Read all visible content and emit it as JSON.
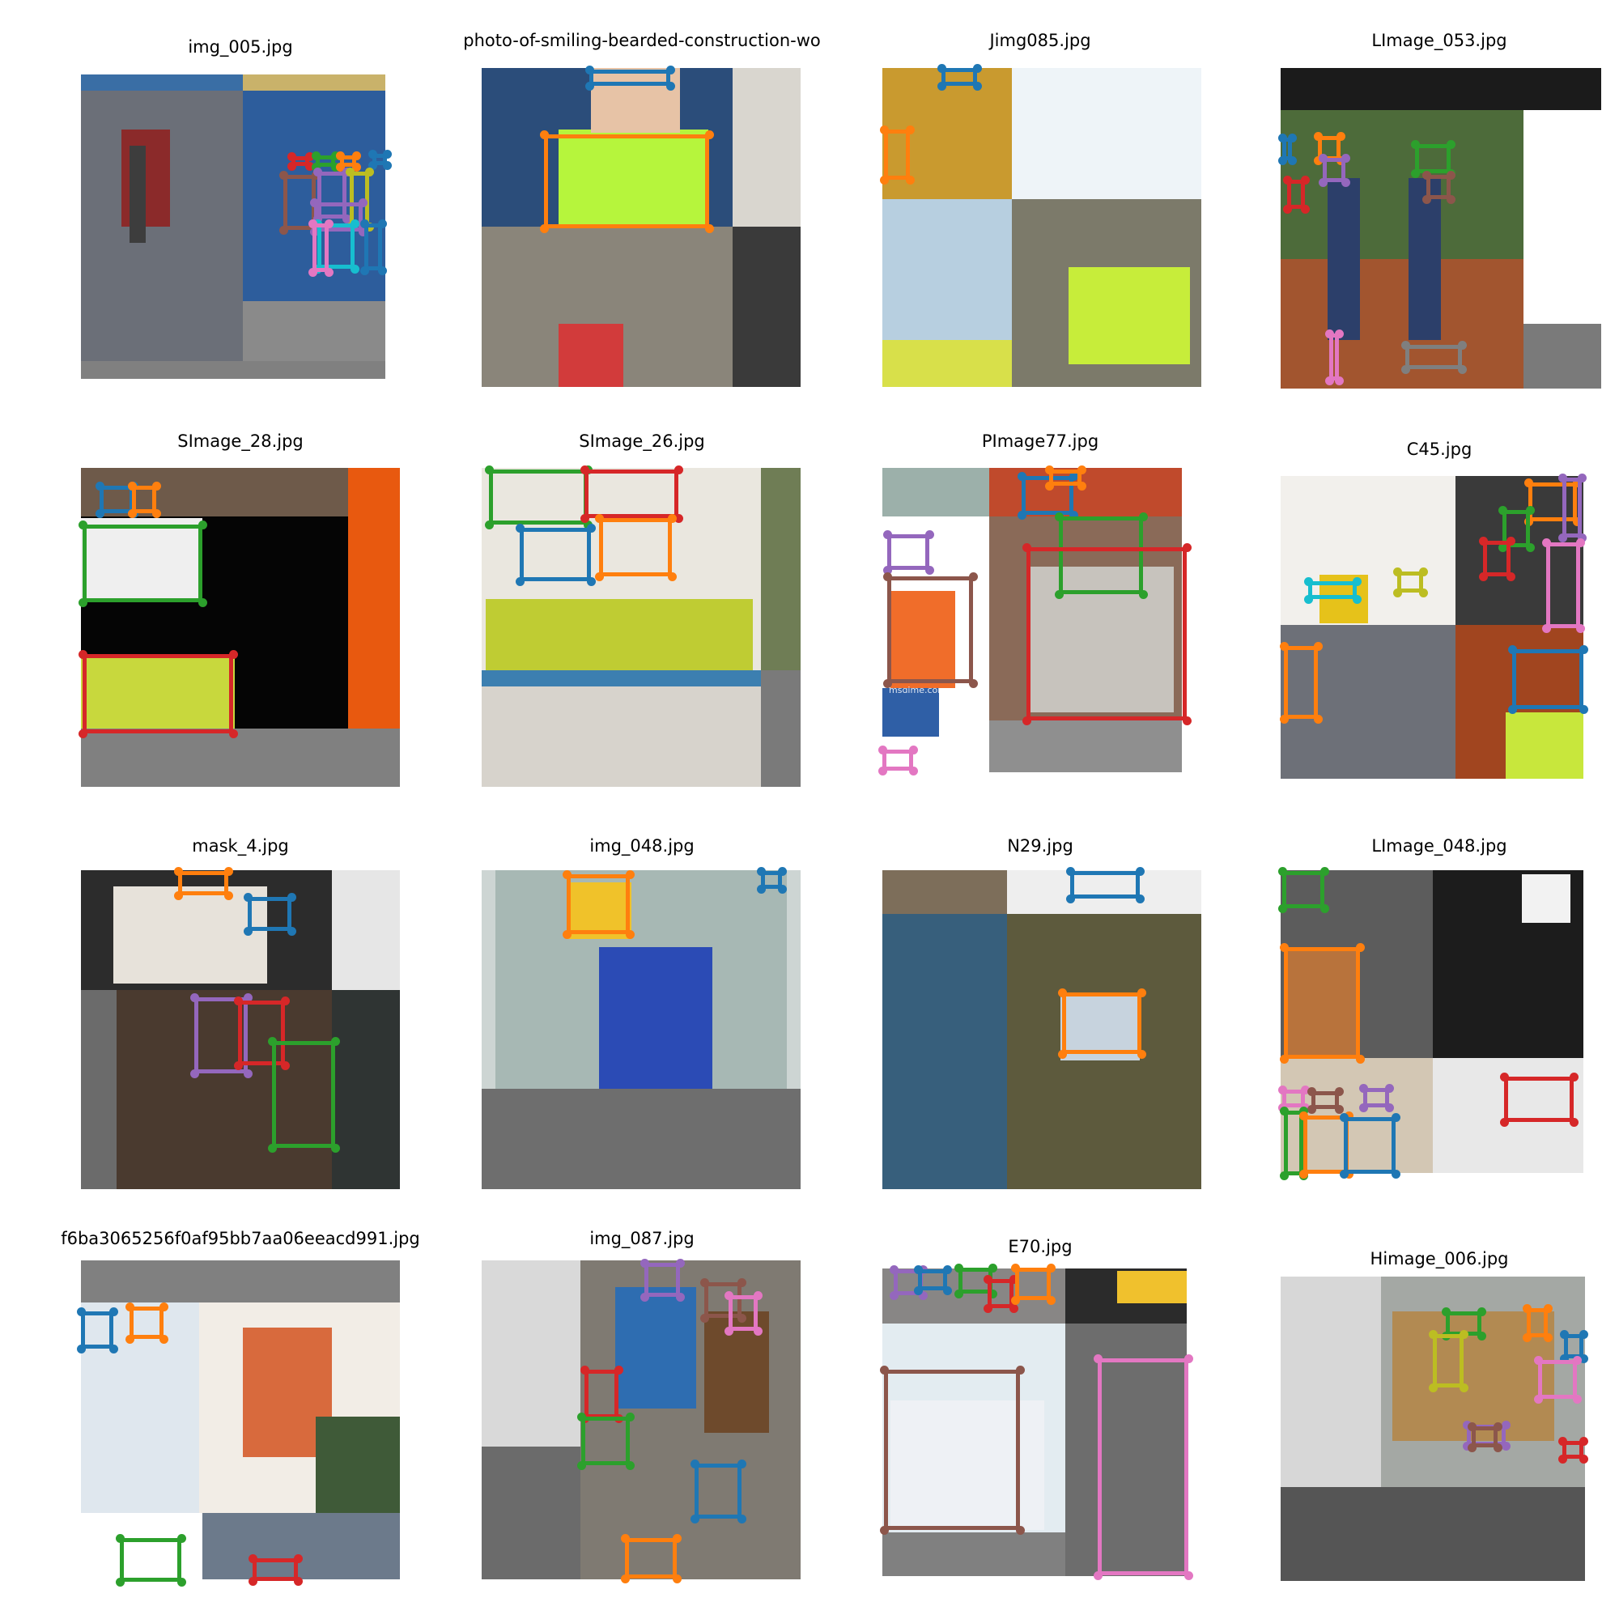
{
  "grid": {
    "cells": [
      {
        "title": "img_005.jpg"
      },
      {
        "title": "photo-of-smiling-bearded-construction-wo"
      },
      {
        "title": "Jimg085.jpg"
      },
      {
        "title": "LImage_053.jpg"
      },
      {
        "title": "SImage_28.jpg"
      },
      {
        "title": "SImage_26.jpg"
      },
      {
        "title": "PImage77.jpg",
        "watermark": "msɑime.com"
      },
      {
        "title": "C45.jpg"
      },
      {
        "title": "mask_4.jpg"
      },
      {
        "title": "img_048.jpg"
      },
      {
        "title": "N29.jpg"
      },
      {
        "title": "LImage_048.jpg"
      },
      {
        "title": "f6ba3065256f0af95bb7aa06eeacd991.jpg"
      },
      {
        "title": "img_087.jpg"
      },
      {
        "title": "E70.jpg"
      },
      {
        "title": "Himage_006.jpg"
      }
    ]
  },
  "palette": {
    "blue": "#1f77b4",
    "orange": "#ff7f0e",
    "green": "#2ca02c",
    "red": "#d62728",
    "purple": "#9467bd",
    "brown": "#8c564b",
    "pink": "#e377c2",
    "gray": "#7f7f7f",
    "olive": "#bcbd22",
    "cyan": "#17becf"
  }
}
